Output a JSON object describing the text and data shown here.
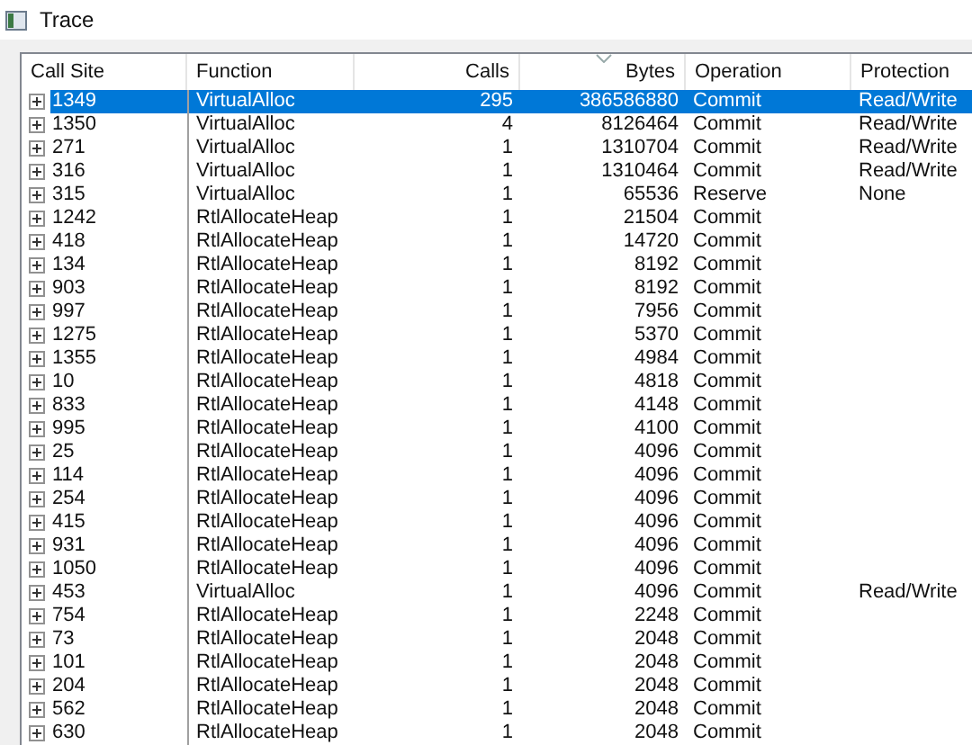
{
  "window": {
    "title": "Trace"
  },
  "table": {
    "columns": [
      {
        "label": "Call Site",
        "sorted": false
      },
      {
        "label": "Function",
        "sorted": false
      },
      {
        "label": "Calls",
        "sorted": false
      },
      {
        "label": "Bytes",
        "sorted": true
      },
      {
        "label": "Operation",
        "sorted": false
      },
      {
        "label": "Protection",
        "sorted": false
      }
    ],
    "rows": [
      {
        "selected": true,
        "cells": [
          "1349",
          "VirtualAlloc",
          "295",
          "386586880",
          "Commit",
          "Read/Write"
        ]
      },
      {
        "selected": false,
        "cells": [
          "1350",
          "VirtualAlloc",
          "4",
          "8126464",
          "Commit",
          "Read/Write"
        ]
      },
      {
        "selected": false,
        "cells": [
          "271",
          "VirtualAlloc",
          "1",
          "1310704",
          "Commit",
          "Read/Write"
        ]
      },
      {
        "selected": false,
        "cells": [
          "316",
          "VirtualAlloc",
          "1",
          "1310464",
          "Commit",
          "Read/Write"
        ]
      },
      {
        "selected": false,
        "cells": [
          "315",
          "VirtualAlloc",
          "1",
          "65536",
          "Reserve",
          "None"
        ]
      },
      {
        "selected": false,
        "cells": [
          "1242",
          "RtlAllocateHeap",
          "1",
          "21504",
          "Commit"
        ]
      },
      {
        "selected": false,
        "cells": [
          "418",
          "RtlAllocateHeap",
          "1",
          "14720",
          "Commit"
        ]
      },
      {
        "selected": false,
        "cells": [
          "134",
          "RtlAllocateHeap",
          "1",
          "8192",
          "Commit"
        ]
      },
      {
        "selected": false,
        "cells": [
          "903",
          "RtlAllocateHeap",
          "1",
          "8192",
          "Commit"
        ]
      },
      {
        "selected": false,
        "cells": [
          "997",
          "RtlAllocateHeap",
          "1",
          "7956",
          "Commit"
        ]
      },
      {
        "selected": false,
        "cells": [
          "1275",
          "RtlAllocateHeap",
          "1",
          "5370",
          "Commit"
        ]
      },
      {
        "selected": false,
        "cells": [
          "1355",
          "RtlAllocateHeap",
          "1",
          "4984",
          "Commit"
        ]
      },
      {
        "selected": false,
        "cells": [
          "10",
          "RtlAllocateHeap",
          "1",
          "4818",
          "Commit"
        ]
      },
      {
        "selected": false,
        "cells": [
          "833",
          "RtlAllocateHeap",
          "1",
          "4148",
          "Commit"
        ]
      },
      {
        "selected": false,
        "cells": [
          "995",
          "RtlAllocateHeap",
          "1",
          "4100",
          "Commit"
        ]
      },
      {
        "selected": false,
        "cells": [
          "25",
          "RtlAllocateHeap",
          "1",
          "4096",
          "Commit"
        ]
      },
      {
        "selected": false,
        "cells": [
          "114",
          "RtlAllocateHeap",
          "1",
          "4096",
          "Commit"
        ]
      },
      {
        "selected": false,
        "cells": [
          "254",
          "RtlAllocateHeap",
          "1",
          "4096",
          "Commit"
        ]
      },
      {
        "selected": false,
        "cells": [
          "415",
          "RtlAllocateHeap",
          "1",
          "4096",
          "Commit"
        ]
      },
      {
        "selected": false,
        "cells": [
          "931",
          "RtlAllocateHeap",
          "1",
          "4096",
          "Commit"
        ]
      },
      {
        "selected": false,
        "cells": [
          "1050",
          "RtlAllocateHeap",
          "1",
          "4096",
          "Commit"
        ]
      },
      {
        "selected": false,
        "cells": [
          "453",
          "VirtualAlloc",
          "1",
          "4096",
          "Commit",
          "Read/Write"
        ]
      },
      {
        "selected": false,
        "cells": [
          "754",
          "RtlAllocateHeap",
          "1",
          "2248",
          "Commit"
        ]
      },
      {
        "selected": false,
        "cells": [
          "73",
          "RtlAllocateHeap",
          "1",
          "2048",
          "Commit"
        ]
      },
      {
        "selected": false,
        "cells": [
          "101",
          "RtlAllocateHeap",
          "1",
          "2048",
          "Commit"
        ]
      },
      {
        "selected": false,
        "cells": [
          "204",
          "RtlAllocateHeap",
          "1",
          "2048",
          "Commit"
        ]
      },
      {
        "selected": false,
        "cells": [
          "562",
          "RtlAllocateHeap",
          "1",
          "2048",
          "Commit"
        ]
      },
      {
        "selected": false,
        "cells": [
          "630",
          "RtlAllocateHeap",
          "1",
          "2048",
          "Commit"
        ]
      }
    ]
  }
}
